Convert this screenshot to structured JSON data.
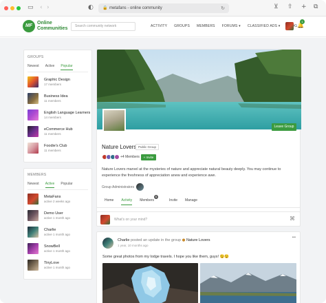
{
  "browser": {
    "url": "metafans - online community",
    "colors": {
      "close": "#ff5f57",
      "minimize": "#febc2e",
      "zoom": "#28c840"
    }
  },
  "site": {
    "logo_mark": "MF",
    "logo_text": "Online Communities",
    "search_placeholder": "Search community network",
    "nav": [
      "ACTIVITY",
      "GROUPS",
      "MEMBERS",
      "FORUMS ▾",
      "CLASSIFIED ADS ▾",
      "BLOG"
    ],
    "notification_count": "1",
    "accent": "#3b9b3f"
  },
  "groups_widget": {
    "title": "GROUPS",
    "tabs": [
      "Newest",
      "Active",
      "Popular"
    ],
    "active_tab": "Popular",
    "items": [
      {
        "name": "Graphic Design",
        "sub": "17 members"
      },
      {
        "name": "Business Idea",
        "sub": "11 members"
      },
      {
        "name": "English Language Learners",
        "sub": "14 members"
      },
      {
        "name": "eCommerce Hub",
        "sub": "11 members"
      },
      {
        "name": "Foodie's Club",
        "sub": "11 members"
      }
    ]
  },
  "members_widget": {
    "title": "MEMBERS",
    "tabs": [
      "Newest",
      "Active",
      "Popular"
    ],
    "active_tab": "Active",
    "items": [
      {
        "name": "MetaFans",
        "sub": "active 2 weeks ago"
      },
      {
        "name": "Demo User",
        "sub": "active 1 month ago"
      },
      {
        "name": "Charlie",
        "sub": "active 1 month ago"
      },
      {
        "name": "SnowBell",
        "sub": "active 1 month ago"
      },
      {
        "name": "TinyLove",
        "sub": "active 1 month ago"
      }
    ]
  },
  "group": {
    "title": "Nature Lovers",
    "type": "Public Group",
    "members_count": "+4 Members",
    "invite_label": "+ Invite",
    "leave_label": "Leave Group",
    "description": "Nature Lovers marvel at the mysteries of nature and appreciate natural beauty deeply. You may continue to experience the freshness of appreciation anew and experience awe.",
    "admins_label": "Group Administrators",
    "tabs": [
      "Home",
      "Activity",
      "Members",
      "Invite",
      "Manage"
    ],
    "active_tab": "Activity",
    "members_badge": "6"
  },
  "composer": {
    "placeholder": "What's on your mind?"
  },
  "post": {
    "author": "Charlie",
    "action": "posted an update in the group",
    "group": "Nature Lovers",
    "time": "1 year, 10 months ago",
    "text": "Some great photos from my lodge travels. I hope you like them, guys! 😉😉",
    "more": "•••"
  }
}
